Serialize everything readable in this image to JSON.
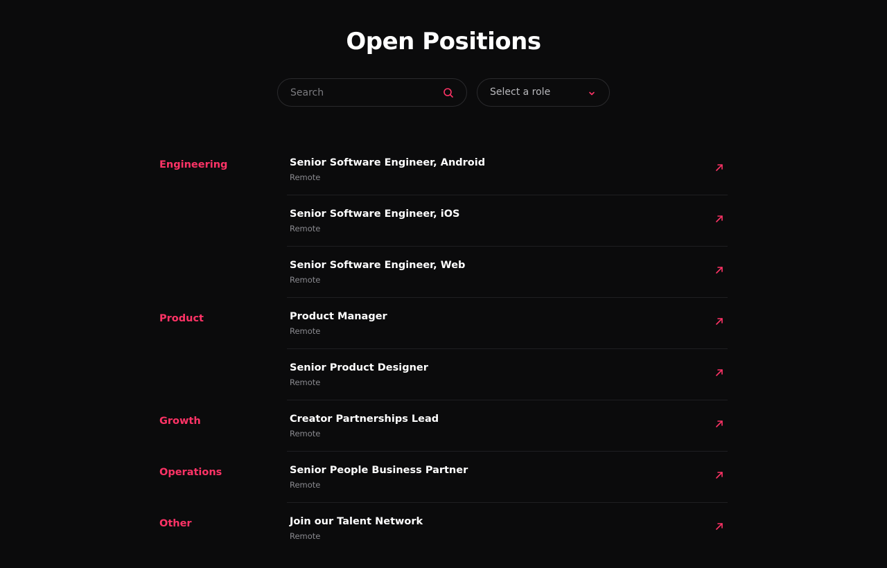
{
  "header": {
    "title": "Open Positions"
  },
  "search": {
    "placeholder": "Search"
  },
  "role_select": {
    "selected": "Select a role"
  },
  "categories": [
    {
      "label": "Engineering"
    },
    {
      "label": "Product"
    },
    {
      "label": "Growth"
    },
    {
      "label": "Operations"
    },
    {
      "label": "Other"
    }
  ],
  "jobs": [
    {
      "title": "Senior Software Engineer, Android",
      "location": "Remote",
      "category": "Engineering"
    },
    {
      "title": "Senior Software Engineer, iOS",
      "location": "Remote",
      "category": "Engineering"
    },
    {
      "title": "Senior Software Engineer, Web",
      "location": "Remote",
      "category": "Engineering"
    },
    {
      "title": "Product Manager",
      "location": "Remote",
      "category": "Product"
    },
    {
      "title": "Senior Product Designer",
      "location": "Remote",
      "category": "Product"
    },
    {
      "title": "Creator Partnerships Lead",
      "location": "Remote",
      "category": "Growth"
    },
    {
      "title": "Senior People Business Partner",
      "location": "Remote",
      "category": "Operations"
    },
    {
      "title": "Join our Talent Network",
      "location": "Remote",
      "category": "Other"
    }
  ],
  "icons": {
    "search": "search-icon",
    "dropdown": "chevron-down-icon",
    "job_link": "arrow-up-right-icon"
  },
  "colors": {
    "accent": "#ff3366",
    "background": "#0b0b0c",
    "text": "#ffffff",
    "muted": "#8a8a8f"
  }
}
